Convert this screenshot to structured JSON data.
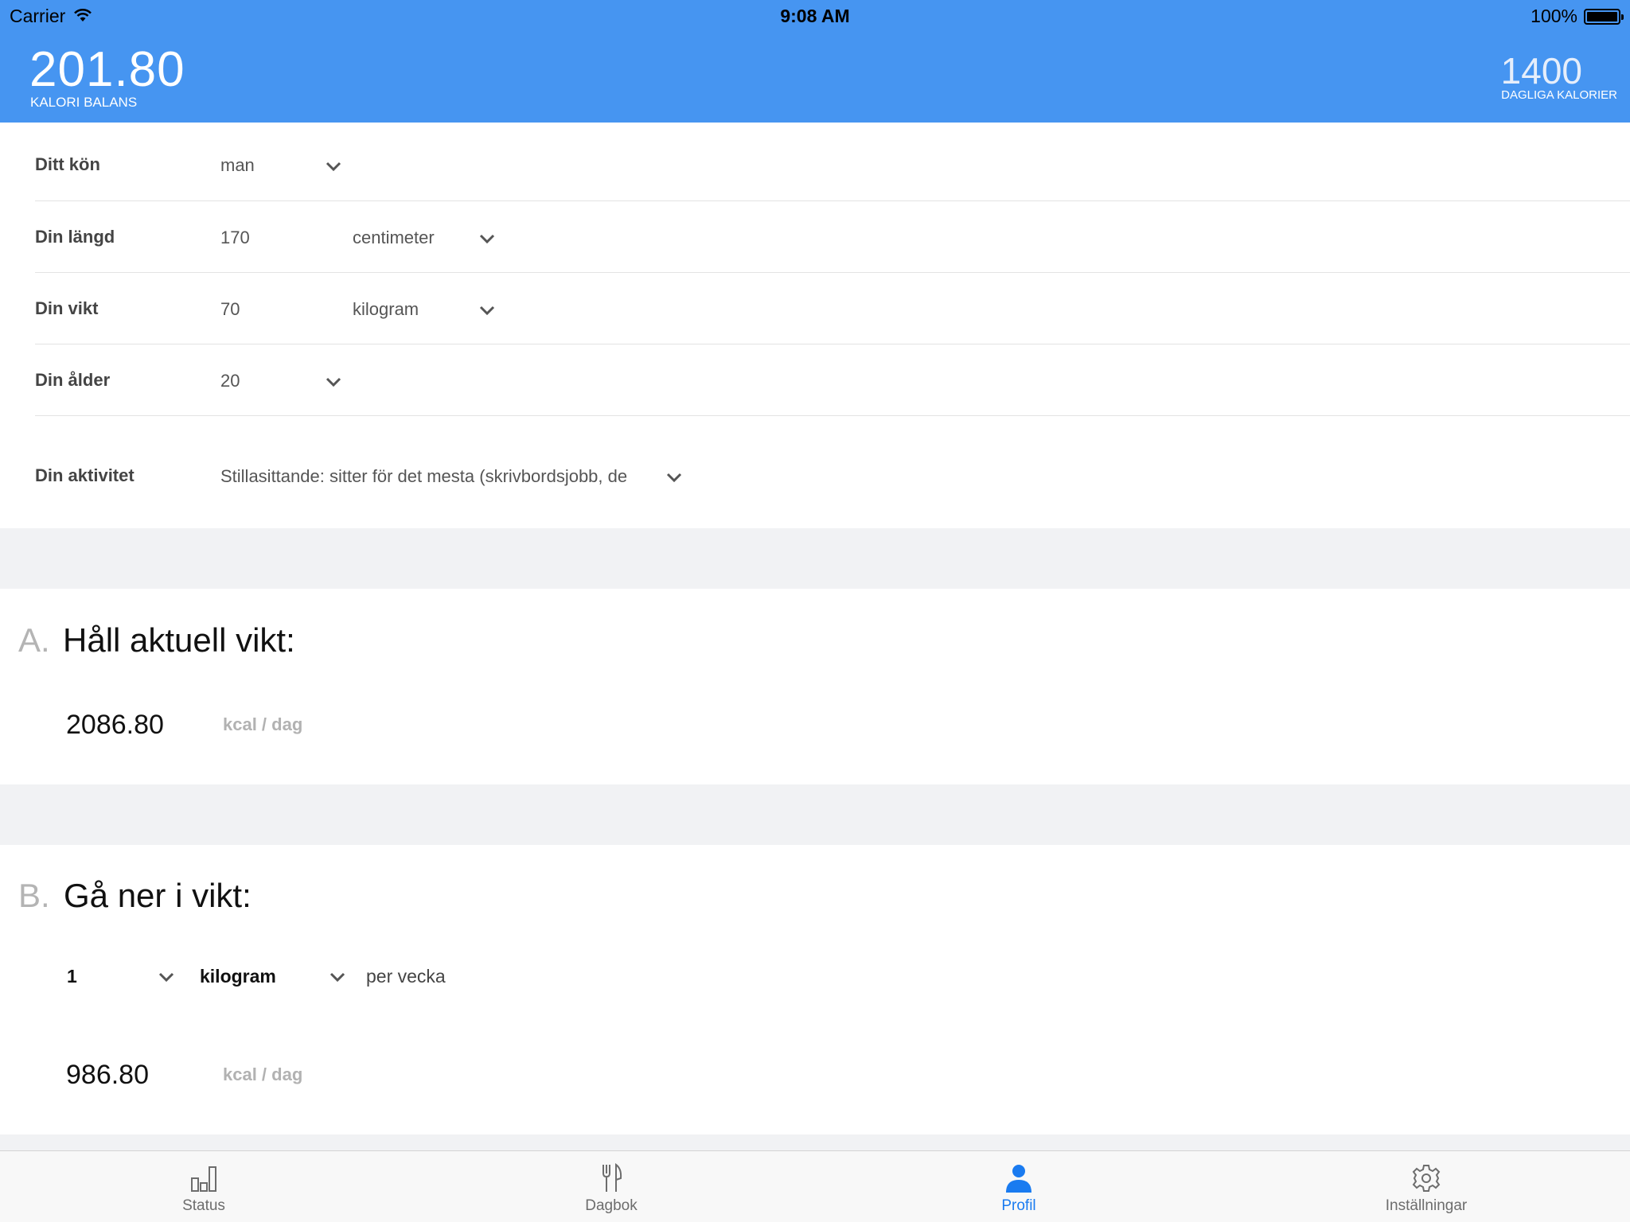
{
  "status_bar": {
    "carrier": "Carrier",
    "time": "9:08 AM",
    "battery": "100%"
  },
  "header": {
    "balance_value": "201.80",
    "balance_label": "KALORI BALANS",
    "daily_value": "1400",
    "daily_label": "DAGLIGA KALORIER",
    "color": "#4695f1"
  },
  "profile": {
    "gender": {
      "label": "Ditt kön",
      "value": "man"
    },
    "height": {
      "label": "Din längd",
      "value": "170",
      "unit": "centimeter"
    },
    "weight": {
      "label": "Din vikt",
      "value": "70",
      "unit": "kilogram"
    },
    "age": {
      "label": "Din ålder",
      "value": "20"
    },
    "activity": {
      "label": "Din aktivitet",
      "value": "Stillasittande: sitter för det mesta (skrivbordsjobb, de"
    }
  },
  "section_a": {
    "letter": "A.",
    "title": "Håll aktuell vikt:",
    "value": "2086.80",
    "unit": "kcal / dag"
  },
  "section_b": {
    "letter": "B.",
    "title": "Gå ner i vikt:",
    "amount": "1",
    "amount_unit": "kilogram",
    "period": "per vecka",
    "value": "986.80",
    "unit": "kcal / dag"
  },
  "tabbar": {
    "active_color": "#1a7bf0",
    "tabs": [
      {
        "label": "Status",
        "icon": "bar-chart-icon"
      },
      {
        "label": "Dagbok",
        "icon": "fork-knife-icon"
      },
      {
        "label": "Profil",
        "icon": "person-icon"
      },
      {
        "label": "Inställningar",
        "icon": "gear-icon"
      }
    ]
  }
}
